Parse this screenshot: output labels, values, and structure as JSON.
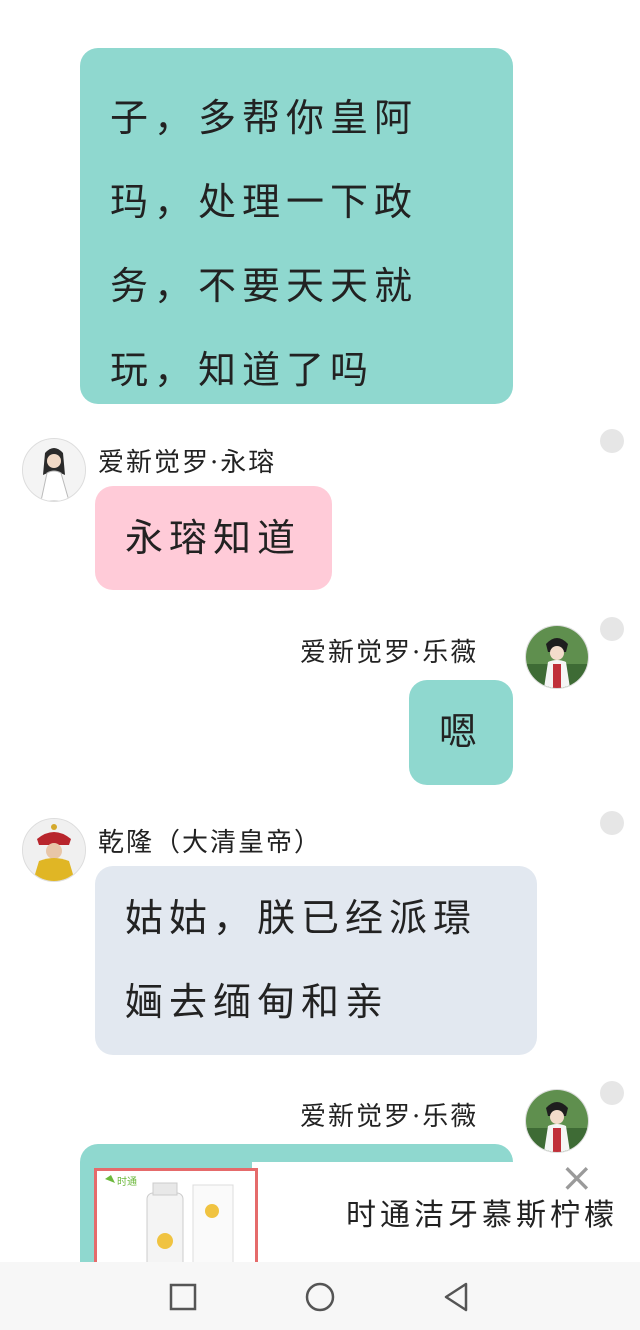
{
  "messages": [
    {
      "sender": "",
      "text": "子，多帮你皇阿\n玛，处理一下政\n务，不要天天就\n玩，知道了吗"
    },
    {
      "sender": "爱新觉罗·永瑢",
      "text": "永瑢知道"
    },
    {
      "sender": "爱新觉罗·乐薇",
      "text": "嗯"
    },
    {
      "sender": "乾隆（大清皇帝）",
      "text": "姑姑，朕已经派璟\n婳去缅甸和亲"
    },
    {
      "sender": "爱新觉罗·乐薇",
      "text": ""
    }
  ],
  "ad": {
    "title": "时通洁牙慕斯柠檬",
    "brand": "时通",
    "close": "×",
    "subtitle": "……"
  },
  "icons": {
    "back": "back-icon",
    "home": "home-icon",
    "recents": "recents-icon"
  },
  "colors": {
    "teal_bubble": "#8fd8cf",
    "pink_bubble": "#ffcbd8",
    "grey_bubble": "#e2e8f0"
  }
}
